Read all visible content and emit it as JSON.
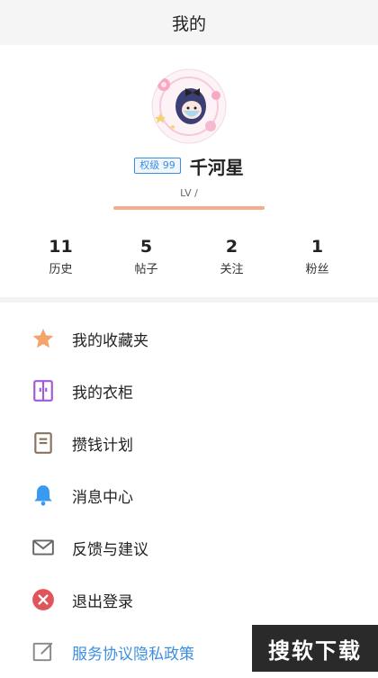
{
  "header": {
    "title": "我的"
  },
  "profile": {
    "rank_badge": "权级 99",
    "username": "千河星",
    "level_text": "LV /",
    "level_progress": 1.0
  },
  "stats": [
    {
      "value": "11",
      "label": "历史"
    },
    {
      "value": "5",
      "label": "帖子"
    },
    {
      "value": "2",
      "label": "关注"
    },
    {
      "value": "1",
      "label": "粉丝"
    }
  ],
  "menu": [
    {
      "label": "我的收藏夹",
      "icon": "star-icon",
      "color": "#f4a36b"
    },
    {
      "label": "我的衣柜",
      "icon": "wardrobe-icon",
      "color": "#a05ad6"
    },
    {
      "label": "攒钱计划",
      "icon": "notebook-icon",
      "color": "#8a7360"
    },
    {
      "label": "消息中心",
      "icon": "bell-icon",
      "color": "#3a9af0"
    },
    {
      "label": "反馈与建议",
      "icon": "envelope-icon",
      "color": "#666666"
    },
    {
      "label": "退出登录",
      "icon": "close-circle-icon",
      "color": "#e0555b"
    },
    {
      "label": "服务协议隐私政策",
      "icon": "edit-icon",
      "color": "#888888"
    }
  ],
  "watermark": {
    "text": "搜软下载"
  },
  "colors": {
    "accent": "#3b8fe0",
    "level_bar": "#f2ad8a"
  }
}
